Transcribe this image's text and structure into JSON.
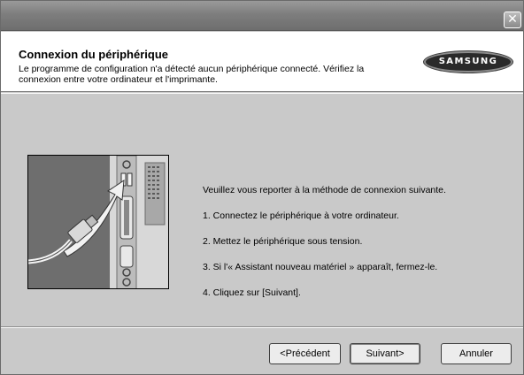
{
  "window": {
    "close_glyph": "✕"
  },
  "header": {
    "title": "Connexion du périphérique",
    "description_line1": "Le programme de configuration n'a détecté aucun périphérique connecté. Vérifiez la",
    "description_line2": "connexion entre votre ordinateur et l'imprimante.",
    "brand_logo": "SAMSUNG"
  },
  "illustration": {
    "icon": "usb-connection-illustration"
  },
  "instructions": {
    "intro": "Veuillez vous reporter à la méthode de connexion suivante.",
    "steps": [
      "1. Connectez le périphérique à votre ordinateur.",
      "2. Mettez le périphérique sous tension.",
      "3. Si l'« Assistant nouveau matériel » apparaît, fermez-le.",
      "4. Cliquez sur [Suivant]."
    ]
  },
  "buttons": {
    "back": "<Précédent",
    "next": "Suivant>",
    "cancel": "Annuler"
  }
}
